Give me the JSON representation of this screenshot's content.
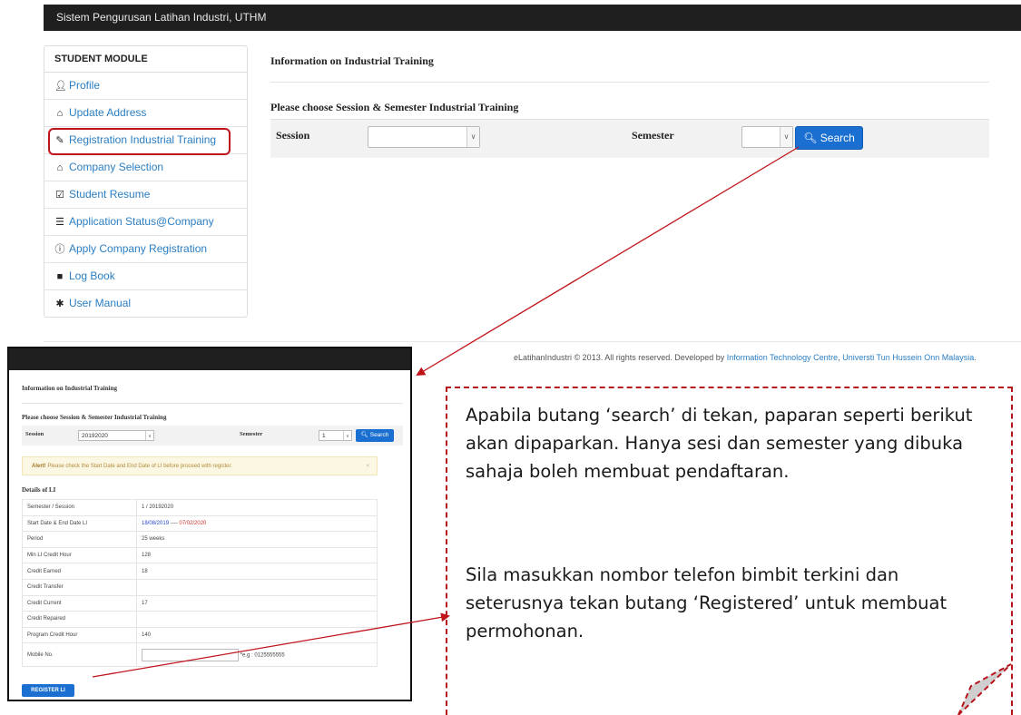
{
  "navbar": {
    "brand": "Sistem Pengurusan Latihan Industri, UTHM"
  },
  "sidebar": {
    "heading": "STUDENT MODULE",
    "items": [
      {
        "label": "Profile",
        "icon": "user-icon"
      },
      {
        "label": "Update Address",
        "icon": "home-icon"
      },
      {
        "label": "Registration Industrial Training",
        "icon": "pencil-icon"
      },
      {
        "label": "Company Selection",
        "icon": "home-icon"
      },
      {
        "label": "Student Resume",
        "icon": "edit-icon"
      },
      {
        "label": "Application Status@Company",
        "icon": "list-icon"
      },
      {
        "label": "Apply Company Registration",
        "icon": "info-circle-icon"
      },
      {
        "label": "Log Book",
        "icon": "book-icon"
      },
      {
        "label": "User Manual",
        "icon": "asterisk-icon"
      }
    ]
  },
  "main": {
    "title": "Information on Industrial Training",
    "subtitle": "Please choose Session & Semester Industrial Training",
    "session_label": "Session",
    "session_value": "",
    "semester_label": "Semester",
    "semester_value": "",
    "search_label": "Search"
  },
  "footer": {
    "text": "eLatihanIndustri © 2013. All rights reserved. Developed by ",
    "link1": "Information Technology Centre",
    "sep": ", ",
    "link2": "Universti Tun Hussein Onn Malaysia",
    "end": "."
  },
  "inset": {
    "title": "Information on Industrial Training",
    "subtitle": "Please choose Session & Semester Industrial Training",
    "session_label": "Session",
    "session_value": "20192020",
    "semester_label": "Semester",
    "semester_value": "1",
    "search_label": "Search",
    "alert_strong": "Alert!",
    "alert_text": " Please check the Start Date and End Date of LI before proceed with register.",
    "alert_close": "×",
    "details_title": "Details of LI",
    "rows": [
      {
        "k": "Semester / Session",
        "v": "1 / 20192020"
      },
      {
        "k": "Start Date & End Date LI",
        "v": ""
      },
      {
        "k": "Period",
        "v": "25 weeks"
      },
      {
        "k": "Min LI Credit Hour",
        "v": "128"
      },
      {
        "k": "Credit Earned",
        "v": "18"
      },
      {
        "k": "Credit Transfer",
        "v": ""
      },
      {
        "k": "Credit Current",
        "v": "17"
      },
      {
        "k": "Credit Repaired",
        "v": ""
      },
      {
        "k": "Program Credit Hour",
        "v": "140"
      },
      {
        "k": "Mobile No.",
        "v": ""
      }
    ],
    "start_date": "18/08/2019",
    "date_sep": " ---- ",
    "end_date": "07/02/2020",
    "mobile_hint": "*e.g : 0125555555",
    "register_label": "REGISTER LI"
  },
  "callout": {
    "para1": "Apabila butang ‘search’ di tekan, paparan seperti berikut akan dipaparkan. Hanya sesi dan semester yang dibuka sahaja boleh membuat pendaftaran.",
    "para2": "Sila masukkan nombor telefon bimbit terkini dan seterusnya tekan butang ‘Registered’ untuk membuat permohonan."
  },
  "colors": {
    "accent": "#1a6fd0",
    "highlight": "#c0141b",
    "navbar": "#1f1f1f"
  }
}
